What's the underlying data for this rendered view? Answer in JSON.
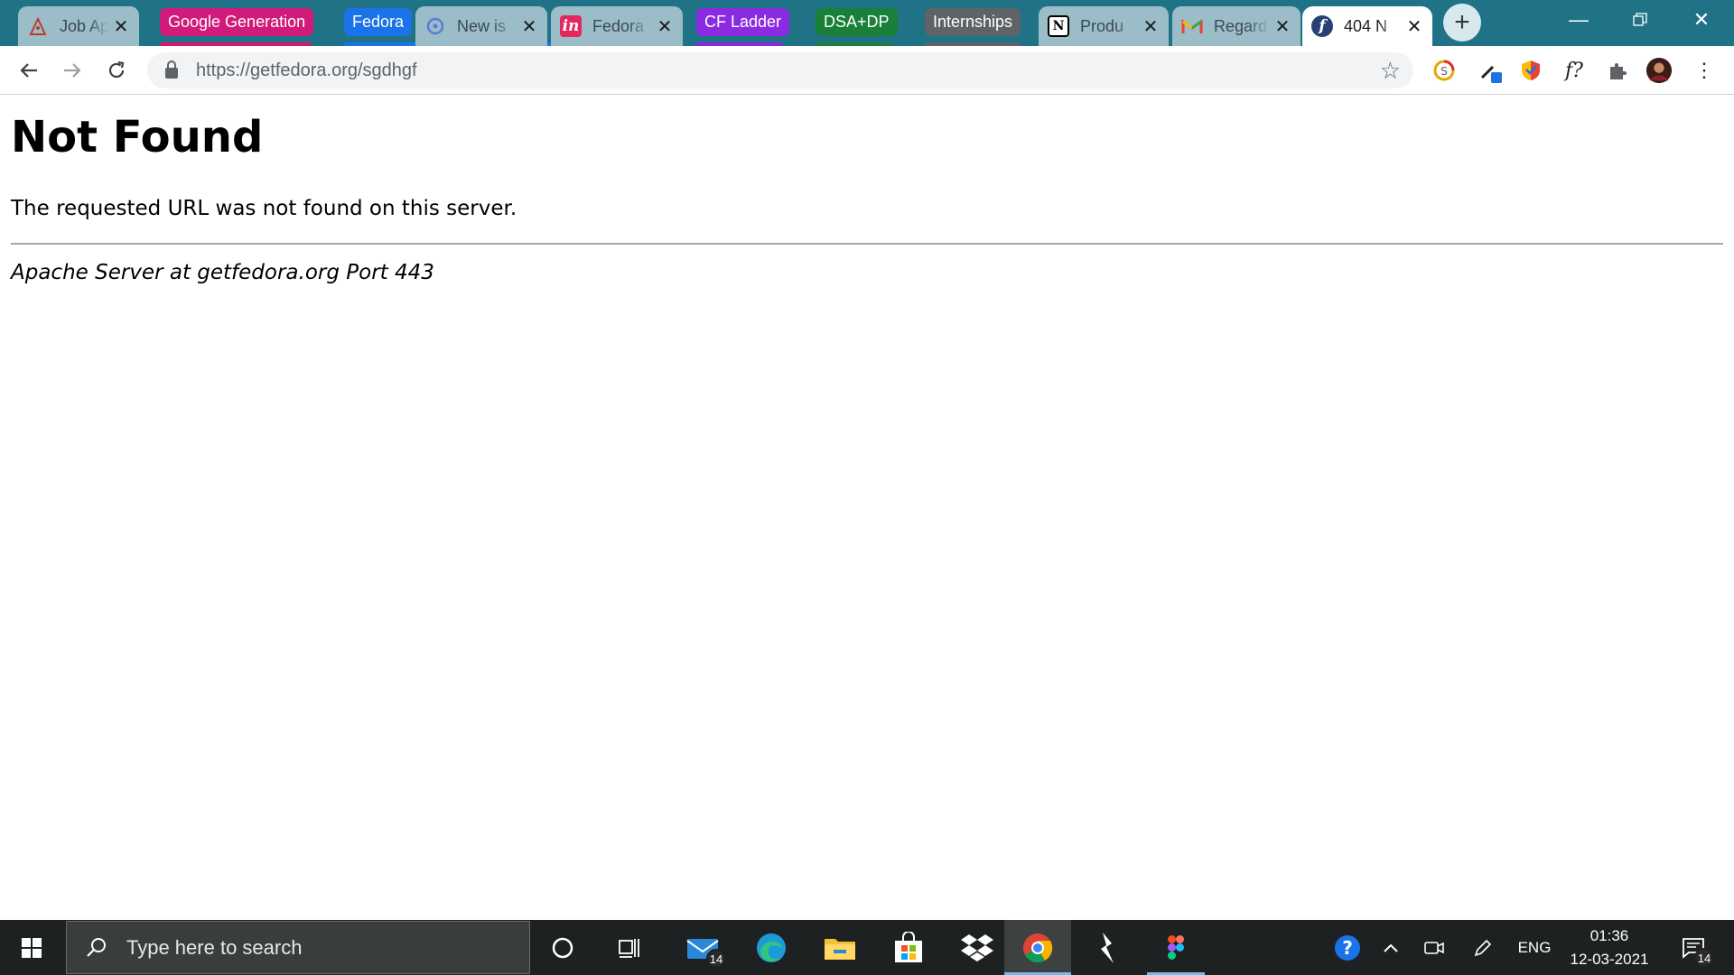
{
  "browser": {
    "tabs": [
      {
        "title": "Job Ap",
        "icon": "job-site-icon"
      },
      {
        "title": "New is",
        "icon": "github-issue-icon"
      },
      {
        "title": "Fedora",
        "icon": "invision-icon"
      },
      {
        "title": "Produ",
        "icon": "notion-icon"
      },
      {
        "title": "Regard",
        "icon": "gmail-icon"
      },
      {
        "title": "404 N",
        "icon": "fedora-icon"
      }
    ],
    "groups": [
      {
        "label": "Google Generation",
        "color": "#d01b7b"
      },
      {
        "label": "Fedora",
        "color": "#1a73e8"
      },
      {
        "label": "CF Ladder",
        "color": "#8a2be2"
      },
      {
        "label": "DSA+DP",
        "color": "#188038"
      },
      {
        "label": "Internships",
        "color": "#5f6368"
      }
    ],
    "url": "https://getfedora.org/sgdhgf"
  },
  "page": {
    "heading": "Not Found",
    "message": "The requested URL was not found on this server.",
    "address": "Apache Server at getfedora.org Port 443"
  },
  "taskbar": {
    "search_placeholder": "Type here to search",
    "mail_badge": "14",
    "language": "ENG",
    "time": "01:36",
    "date": "12-03-2021",
    "notification_badge": "14"
  }
}
